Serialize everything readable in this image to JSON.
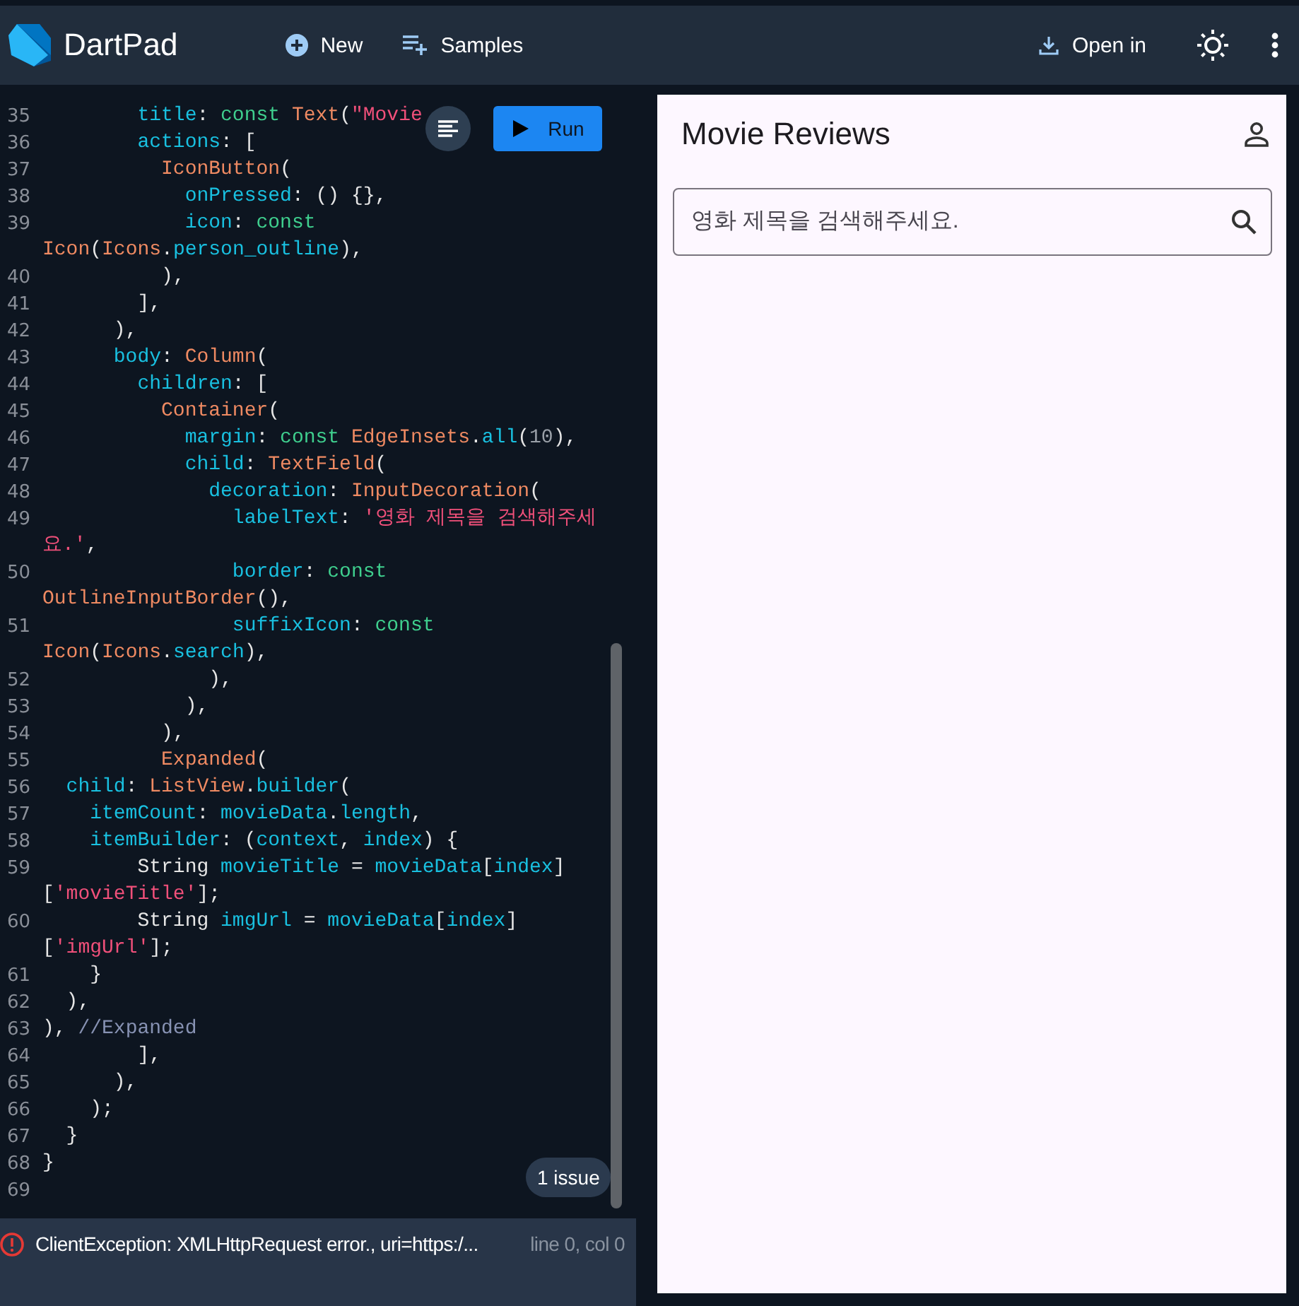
{
  "header": {
    "title": "DartPad",
    "actions": [
      {
        "kind": "new",
        "label": "New"
      },
      {
        "kind": "samples",
        "label": "Samples"
      }
    ],
    "open_in": "Open in"
  },
  "editor": {
    "run_button": "Run",
    "lines": [
      {
        "number": "35",
        "tokens": [
          {
            "kind": "prop",
            "text": "        title"
          },
          {
            "kind": "plain",
            "text": ": "
          },
          {
            "kind": "keyword",
            "text": "const "
          },
          {
            "kind": "type",
            "text": "Text"
          },
          {
            "kind": "plain",
            "text": "("
          },
          {
            "kind": "string",
            "text": "\"Movie"
          }
        ]
      },
      {
        "number": "36",
        "tokens": [
          {
            "kind": "prop",
            "text": "        actions"
          },
          {
            "kind": "plain",
            "text": ": ["
          }
        ]
      },
      {
        "number": "37",
        "tokens": [
          {
            "kind": "type",
            "text": "          IconButton"
          },
          {
            "kind": "plain",
            "text": "("
          }
        ]
      },
      {
        "number": "38",
        "tokens": [
          {
            "kind": "prop",
            "text": "            onPressed"
          },
          {
            "kind": "plain",
            "text": ": () {},"
          }
        ]
      },
      {
        "number": "39",
        "tokens": [
          {
            "kind": "prop",
            "text": "            icon"
          },
          {
            "kind": "plain",
            "text": ": "
          },
          {
            "kind": "keyword",
            "text": "const"
          }
        ]
      },
      {
        "tokens": [
          {
            "kind": "type",
            "text": "Icon"
          },
          {
            "kind": "plain",
            "text": "("
          },
          {
            "kind": "type",
            "text": "Icons"
          },
          {
            "kind": "plain",
            "text": "."
          },
          {
            "kind": "prop",
            "text": "person_outline"
          },
          {
            "kind": "plain",
            "text": "),"
          }
        ]
      },
      {
        "number": "40",
        "tokens": [
          {
            "kind": "plain",
            "text": "          ),"
          }
        ]
      },
      {
        "number": "41",
        "tokens": [
          {
            "kind": "plain",
            "text": "        ],"
          }
        ]
      },
      {
        "number": "42",
        "tokens": [
          {
            "kind": "plain",
            "text": "      ),"
          }
        ]
      },
      {
        "number": "43",
        "tokens": [
          {
            "kind": "prop",
            "text": "      body"
          },
          {
            "kind": "plain",
            "text": ": "
          },
          {
            "kind": "type",
            "text": "Column"
          },
          {
            "kind": "plain",
            "text": "("
          }
        ]
      },
      {
        "number": "44",
        "tokens": [
          {
            "kind": "prop",
            "text": "        children"
          },
          {
            "kind": "plain",
            "text": ": ["
          }
        ]
      },
      {
        "number": "45",
        "tokens": [
          {
            "kind": "type",
            "text": "          Container"
          },
          {
            "kind": "plain",
            "text": "("
          }
        ]
      },
      {
        "number": "46",
        "tokens": [
          {
            "kind": "prop",
            "text": "            margin"
          },
          {
            "kind": "plain",
            "text": ": "
          },
          {
            "kind": "keyword",
            "text": "const "
          },
          {
            "kind": "type",
            "text": "EdgeInsets"
          },
          {
            "kind": "plain",
            "text": "."
          },
          {
            "kind": "prop",
            "text": "all"
          },
          {
            "kind": "plain",
            "text": "("
          },
          {
            "kind": "number",
            "text": "10"
          },
          {
            "kind": "plain",
            "text": "),"
          }
        ]
      },
      {
        "number": "47",
        "tokens": [
          {
            "kind": "prop",
            "text": "            child"
          },
          {
            "kind": "plain",
            "text": ": "
          },
          {
            "kind": "type",
            "text": "TextField"
          },
          {
            "kind": "plain",
            "text": "("
          }
        ]
      },
      {
        "number": "48",
        "tokens": [
          {
            "kind": "prop",
            "text": "              decoration"
          },
          {
            "kind": "plain",
            "text": ": "
          },
          {
            "kind": "type",
            "text": "InputDecoration"
          },
          {
            "kind": "plain",
            "text": "("
          }
        ]
      },
      {
        "number": "49",
        "tokens": [
          {
            "kind": "prop",
            "text": "                labelText"
          },
          {
            "kind": "plain",
            "text": ": "
          },
          {
            "kind": "string",
            "text": "'영화 제목을 검색해주세"
          }
        ]
      },
      {
        "tokens": [
          {
            "kind": "string",
            "text": "요.'"
          },
          {
            "kind": "plain",
            "text": ","
          }
        ]
      },
      {
        "number": "50",
        "tokens": [
          {
            "kind": "prop",
            "text": "                border"
          },
          {
            "kind": "plain",
            "text": ": "
          },
          {
            "kind": "keyword",
            "text": "const"
          }
        ]
      },
      {
        "tokens": [
          {
            "kind": "type",
            "text": "OutlineInputBorder"
          },
          {
            "kind": "plain",
            "text": "(),"
          }
        ]
      },
      {
        "number": "51",
        "tokens": [
          {
            "kind": "prop",
            "text": "                suffixIcon"
          },
          {
            "kind": "plain",
            "text": ": "
          },
          {
            "kind": "keyword",
            "text": "const"
          }
        ]
      },
      {
        "tokens": [
          {
            "kind": "type",
            "text": "Icon"
          },
          {
            "kind": "plain",
            "text": "("
          },
          {
            "kind": "type",
            "text": "Icons"
          },
          {
            "kind": "plain",
            "text": "."
          },
          {
            "kind": "prop",
            "text": "search"
          },
          {
            "kind": "plain",
            "text": "),"
          }
        ]
      },
      {
        "number": "52",
        "tokens": [
          {
            "kind": "plain",
            "text": "              ),"
          }
        ]
      },
      {
        "number": "53",
        "tokens": [
          {
            "kind": "plain",
            "text": "            ),"
          }
        ]
      },
      {
        "number": "54",
        "tokens": [
          {
            "kind": "plain",
            "text": "          ),"
          }
        ]
      },
      {
        "number": "55",
        "tokens": [
          {
            "kind": "type",
            "text": "          Expanded"
          },
          {
            "kind": "plain",
            "text": "("
          }
        ]
      },
      {
        "number": "56",
        "tokens": [
          {
            "kind": "prop",
            "text": "  child"
          },
          {
            "kind": "plain",
            "text": ": "
          },
          {
            "kind": "type",
            "text": "ListView"
          },
          {
            "kind": "plain",
            "text": "."
          },
          {
            "kind": "prop",
            "text": "builder"
          },
          {
            "kind": "plain",
            "text": "("
          }
        ]
      },
      {
        "number": "57",
        "tokens": [
          {
            "kind": "prop",
            "text": "    itemCount"
          },
          {
            "kind": "plain",
            "text": ": "
          },
          {
            "kind": "prop",
            "text": "movieData"
          },
          {
            "kind": "plain",
            "text": "."
          },
          {
            "kind": "prop",
            "text": "length"
          },
          {
            "kind": "plain",
            "text": ","
          }
        ]
      },
      {
        "number": "58",
        "tokens": [
          {
            "kind": "prop",
            "text": "    itemBuilder"
          },
          {
            "kind": "plain",
            "text": ": ("
          },
          {
            "kind": "prop",
            "text": "context"
          },
          {
            "kind": "plain",
            "text": ", "
          },
          {
            "kind": "prop",
            "text": "index"
          },
          {
            "kind": "plain",
            "text": ") {"
          }
        ]
      },
      {
        "number": "59",
        "tokens": [
          {
            "kind": "plain",
            "text": "        String "
          },
          {
            "kind": "prop",
            "text": "movieTitle"
          },
          {
            "kind": "plain",
            "text": " = "
          },
          {
            "kind": "prop",
            "text": "movieData"
          },
          {
            "kind": "plain",
            "text": "["
          },
          {
            "kind": "prop",
            "text": "index"
          },
          {
            "kind": "plain",
            "text": "]"
          }
        ]
      },
      {
        "tokens": [
          {
            "kind": "plain",
            "text": "["
          },
          {
            "kind": "string",
            "text": "'movieTitle'"
          },
          {
            "kind": "plain",
            "text": "];"
          }
        ]
      },
      {
        "number": "60",
        "tokens": [
          {
            "kind": "plain",
            "text": "        String "
          },
          {
            "kind": "prop",
            "text": "imgUrl"
          },
          {
            "kind": "plain",
            "text": " = "
          },
          {
            "kind": "prop",
            "text": "movieData"
          },
          {
            "kind": "plain",
            "text": "["
          },
          {
            "kind": "prop",
            "text": "index"
          },
          {
            "kind": "plain",
            "text": "]"
          }
        ]
      },
      {
        "tokens": [
          {
            "kind": "plain",
            "text": "["
          },
          {
            "kind": "string",
            "text": "'imgUrl'"
          },
          {
            "kind": "plain",
            "text": "];"
          }
        ]
      },
      {
        "number": "61",
        "tokens": [
          {
            "kind": "plain",
            "text": "    }"
          }
        ]
      },
      {
        "number": "62",
        "tokens": [
          {
            "kind": "plain",
            "text": "  ),"
          }
        ]
      },
      {
        "number": "63",
        "tokens": [
          {
            "kind": "plain",
            "text": "), "
          },
          {
            "kind": "comment",
            "text": "//Expanded"
          }
        ]
      },
      {
        "number": "64",
        "tokens": [
          {
            "kind": "plain",
            "text": "        ],"
          }
        ]
      },
      {
        "number": "65",
        "tokens": [
          {
            "kind": "plain",
            "text": "      ),"
          }
        ]
      },
      {
        "number": "66",
        "tokens": [
          {
            "kind": "plain",
            "text": "    );"
          }
        ]
      },
      {
        "number": "67",
        "tokens": [
          {
            "kind": "plain",
            "text": "  }"
          }
        ]
      },
      {
        "number": "68",
        "tokens": [
          {
            "kind": "plain",
            "text": "}"
          }
        ]
      },
      {
        "number": "69"
      }
    ],
    "issues_badge": "1 issue"
  },
  "status_bar": {
    "message": "ClientException: XMLHttpRequest error., uri=https:/...",
    "position": "line 0, col 0"
  },
  "preview": {
    "app_title": "Movie Reviews",
    "search": {
      "placeholder": "영화 제목을 검색해주세요."
    }
  }
}
